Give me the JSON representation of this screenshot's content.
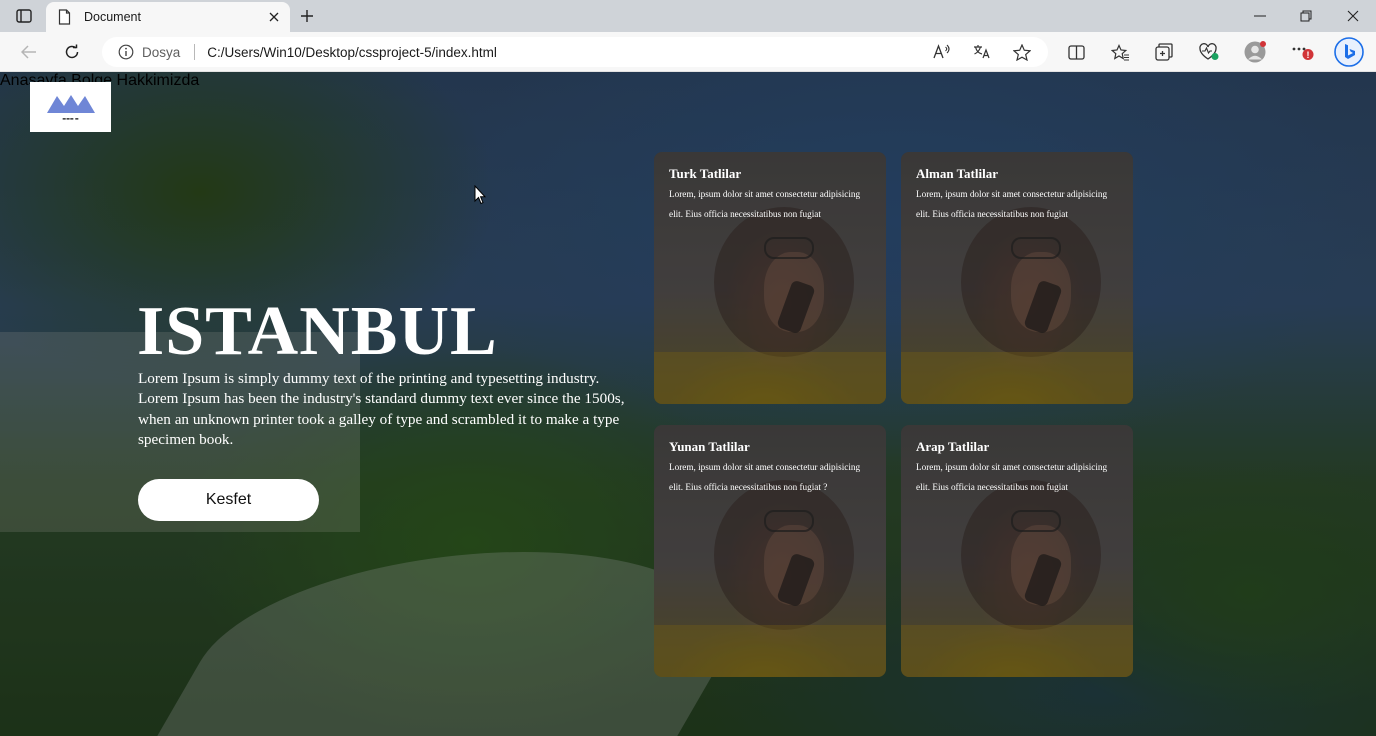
{
  "browser": {
    "tab_title": "Document",
    "address_prefix": "Dosya",
    "url": "C:/Users/Win10/Desktop/cssproject-5/index.html",
    "icons": [
      "tab-actions-icon",
      "document-icon",
      "close-icon",
      "plus-icon",
      "minimize-icon",
      "restore-icon",
      "close-window-icon",
      "back-arrow-icon",
      "refresh-icon",
      "info-icon",
      "read-aloud-icon",
      "translate-icon",
      "favorite-star-icon",
      "split-screen-icon",
      "favorites-icon",
      "collections-icon",
      "browser-essentials-icon",
      "profile-avatar-icon",
      "more-icon",
      "bing-copilot-icon"
    ],
    "notification_badge": "!"
  },
  "site": {
    "logo_text": "Mountain Logo",
    "nav": [
      {
        "label": "Anasayfa"
      },
      {
        "label": "Bolge"
      },
      {
        "label": "Hakkimizda"
      }
    ],
    "hero": {
      "title": "ISTANBUL",
      "text": "Lorem Ipsum is simply dummy text of the printing and typesetting industry. Lorem Ipsum has been the industry's standard dummy text ever since the 1500s, when an unknown printer took a galley of type and scrambled it to make a type specimen book.",
      "button": "Kesfet"
    },
    "cards": [
      {
        "title": "Turk Tatlilar",
        "text": "Lorem, ipsum dolor sit amet consectetur adipisicing elit. Eius officia necessitatibus non fugiat"
      },
      {
        "title": "Alman Tatlilar",
        "text": "Lorem, ipsum dolor sit amet consectetur adipisicing elit. Eius officia necessitatibus non fugiat"
      },
      {
        "title": "Yunan Tatlilar",
        "text": "Lorem, ipsum dolor sit amet consectetur adipisicing elit. Eius officia necessitatibus non fugiat ?"
      },
      {
        "title": "Arap Tatlilar",
        "text": "Lorem, ipsum dolor sit amet consectetur adipisicing elit. Eius officia necessitatibus non fugiat"
      }
    ]
  },
  "colors": {
    "tabbar": "#cfd3d8",
    "toolbar": "#f7f7f7",
    "logo_blue": "#6f86d6",
    "text": "#ffffff",
    "badge_red": "#d13438",
    "bing_blue": "#1b6ee8"
  }
}
